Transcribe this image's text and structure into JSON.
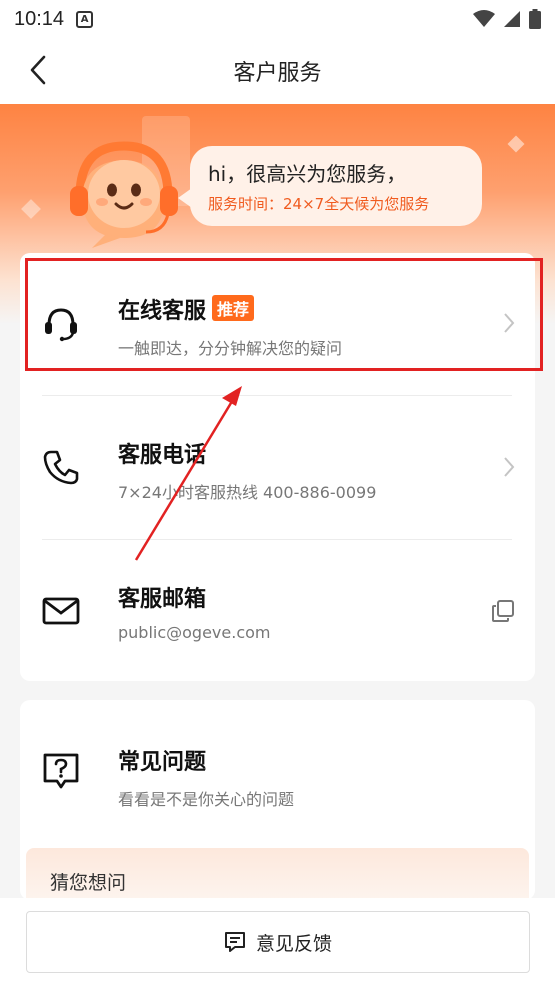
{
  "status_bar": {
    "time": "10:14",
    "notification_icon_letter": "A",
    "icons": [
      "wifi-icon",
      "signal-icon",
      "battery-icon"
    ]
  },
  "nav": {
    "title": "客户服务",
    "back_icon": "back-arrow-icon"
  },
  "hero": {
    "greeting": "hi，很高兴为您服务，",
    "hours": "服务时间：24×7全天候为您服务",
    "accent_color": "#ff7a35"
  },
  "contact_options": [
    {
      "title": "在线客服",
      "badge": "推荐",
      "subtitle": "一触即达，分分钟解决您的疑问",
      "icon": "headset-icon",
      "action_icon": "chevron-right-icon"
    },
    {
      "title": "客服电话",
      "subtitle": "7×24小时客服热线 400-886-0099",
      "icon": "phone-icon",
      "action_icon": "chevron-right-icon"
    },
    {
      "title": "客服邮箱",
      "subtitle": "public@ogeve.com",
      "icon": "mail-icon",
      "action_icon": "copy-icon"
    }
  ],
  "faq": {
    "title": "常见问题",
    "subtitle": "看看是不是你关心的问题",
    "icon": "question-bubble-icon",
    "guess_label": "猜您想问"
  },
  "feedback": {
    "label": "意见反馈",
    "icon": "feedback-icon"
  },
  "annotation": {
    "highlight_color": "#e22222",
    "target": "在线客服"
  }
}
